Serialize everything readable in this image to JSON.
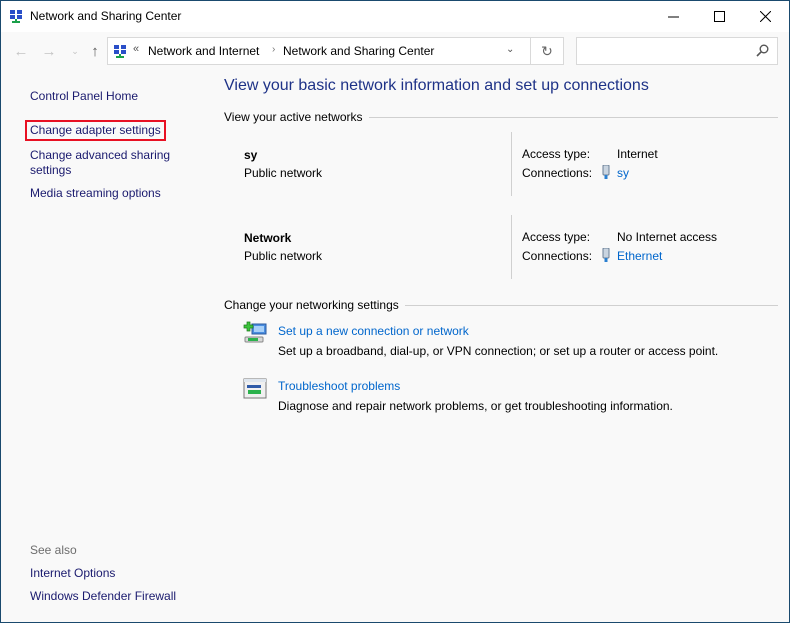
{
  "window": {
    "title": "Network and Sharing Center",
    "controls": {
      "minimize": "minimize",
      "maximize": "maximize",
      "close": "close"
    }
  },
  "navbar": {
    "breadcrumb_overflow": "«",
    "breadcrumbs": [
      "Network and Internet",
      "Network and Sharing Center"
    ],
    "separator": "›",
    "search_value": "",
    "search_placeholder": ""
  },
  "sidebar": {
    "links": [
      {
        "label": "Control Panel Home"
      },
      {
        "label": "Change adapter settings",
        "highlighted": true
      },
      {
        "label": "Change advanced sharing settings",
        "line1": "Change advanced sharing",
        "line2": "settings"
      },
      {
        "label": "Media streaming options"
      }
    ],
    "see_also_label": "See also",
    "see_also": [
      {
        "label": "Internet Options"
      },
      {
        "label": "Windows Defender Firewall"
      }
    ]
  },
  "main": {
    "title": "View your basic network information and set up connections",
    "active_networks_header": "View your active networks",
    "access_type_label": "Access type:",
    "connections_label": "Connections:",
    "networks": [
      {
        "name": "sy",
        "category": "Public network",
        "access_type": "Internet",
        "connection": "sy"
      },
      {
        "name": "Network",
        "category": "Public network",
        "access_type": "No Internet access",
        "connection": "Ethernet"
      }
    ],
    "settings_header": "Change your networking settings",
    "tasks": [
      {
        "link": "Set up a new connection or network",
        "description": "Set up a broadband, dial-up, or VPN connection; or set up a router or access point.",
        "icon": "new-connection-icon"
      },
      {
        "link": "Troubleshoot problems",
        "description": "Diagnose and repair network problems, or get troubleshooting information.",
        "icon": "troubleshoot-icon"
      }
    ]
  },
  "colors": {
    "accent_link": "#0066cc",
    "sidebar_link": "#1a1a6e",
    "title": "#1e3287",
    "highlight_box": "#e81123"
  }
}
